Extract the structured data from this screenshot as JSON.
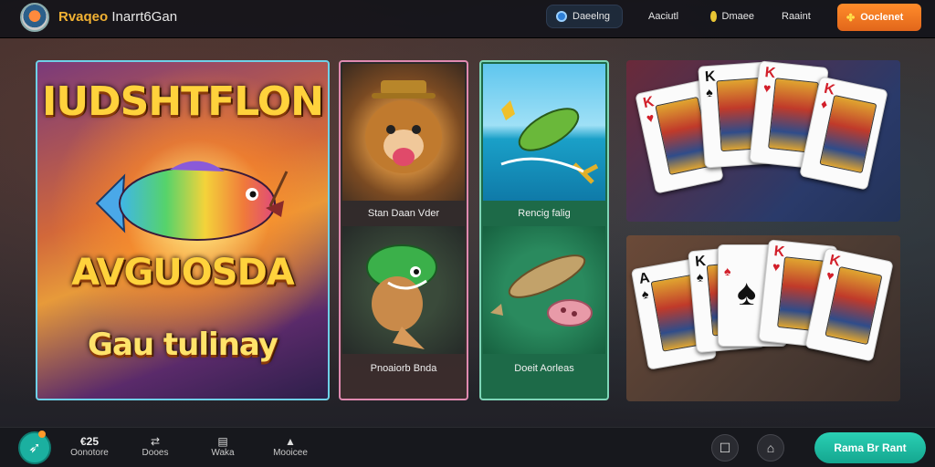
{
  "header": {
    "brand_primary": "Rvaqeo",
    "brand_secondary": "Inarrt6Gan",
    "nav_pills": [
      {
        "label": "Daeelng"
      },
      {
        "label": "Aaciutl"
      },
      {
        "label": "Dmaee"
      },
      {
        "label": "Raaint"
      }
    ],
    "cta_label": "Ooclenet"
  },
  "hero": {
    "title_top": "IUDSHTFLON",
    "title_mid": "AVGUOSDA",
    "title_bottom": "Gau tulinay"
  },
  "tiles": [
    {
      "caption": "Stan Daan Vder"
    },
    {
      "caption": "Pnoaiorb Bnda"
    },
    {
      "caption": "Rencig falig"
    },
    {
      "caption": "Doeit Aorleas"
    }
  ],
  "cards_top": [
    {
      "rank": "K",
      "suit": "♥",
      "color": "red"
    },
    {
      "rank": "K",
      "suit": "♠",
      "color": "black"
    },
    {
      "rank": "K",
      "suit": "♥",
      "color": "red"
    },
    {
      "rank": "K",
      "suit": "♦",
      "color": "red"
    }
  ],
  "cards_bottom": [
    {
      "rank": "A",
      "suit": "♠",
      "color": "black"
    },
    {
      "rank": "K",
      "suit": "♠",
      "color": "black"
    },
    {
      "rank": "",
      "suit": "♠",
      "color": "red"
    },
    {
      "rank": "K",
      "suit": "♥",
      "color": "red"
    },
    {
      "rank": "K",
      "suit": "♥",
      "color": "red"
    }
  ],
  "bottom_nav": {
    "balance": "€25",
    "items": [
      {
        "label": "Oonotore"
      },
      {
        "label": "Dooes"
      },
      {
        "label": "Waka"
      },
      {
        "label": "Mooicee"
      }
    ],
    "cta_label": "Rama Br Rant"
  },
  "colors": {
    "accent": "#1bb0a0",
    "cta_orange": "#ff8c2a",
    "hero_border": "#6fd0e8"
  }
}
